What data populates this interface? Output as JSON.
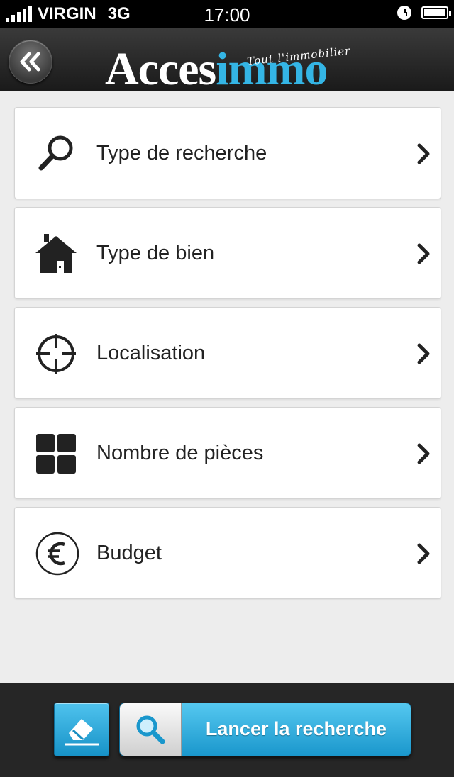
{
  "status_bar": {
    "carrier": "VIRGIN",
    "network": "3G",
    "time": "17:00",
    "icons": [
      "signal-icon",
      "alarm-clock-icon",
      "battery-icon"
    ]
  },
  "header": {
    "back_icon": "double-chevron-left-icon",
    "logo_part1": "Acces",
    "logo_part2": "immo",
    "tagline": "Tout l'immobilier",
    "colors": {
      "logo_accent": "#34b5e5",
      "header_bg": "#2a2a2a"
    }
  },
  "menu": {
    "items": [
      {
        "label": "Type de recherche",
        "icon": "search-icon"
      },
      {
        "label": "Type de bien",
        "icon": "house-icon"
      },
      {
        "label": "Localisation",
        "icon": "crosshair-icon"
      },
      {
        "label": "Nombre de pièces",
        "icon": "rooms-grid-icon"
      },
      {
        "label": "Budget",
        "icon": "euro-icon"
      }
    ]
  },
  "footer": {
    "reset_icon": "eraser-icon",
    "search_icon": "magnifier-icon",
    "launch_label": "Lancer la recherche",
    "colors": {
      "button_blue": "#2aa8dc",
      "footer_bg": "#262626"
    }
  }
}
